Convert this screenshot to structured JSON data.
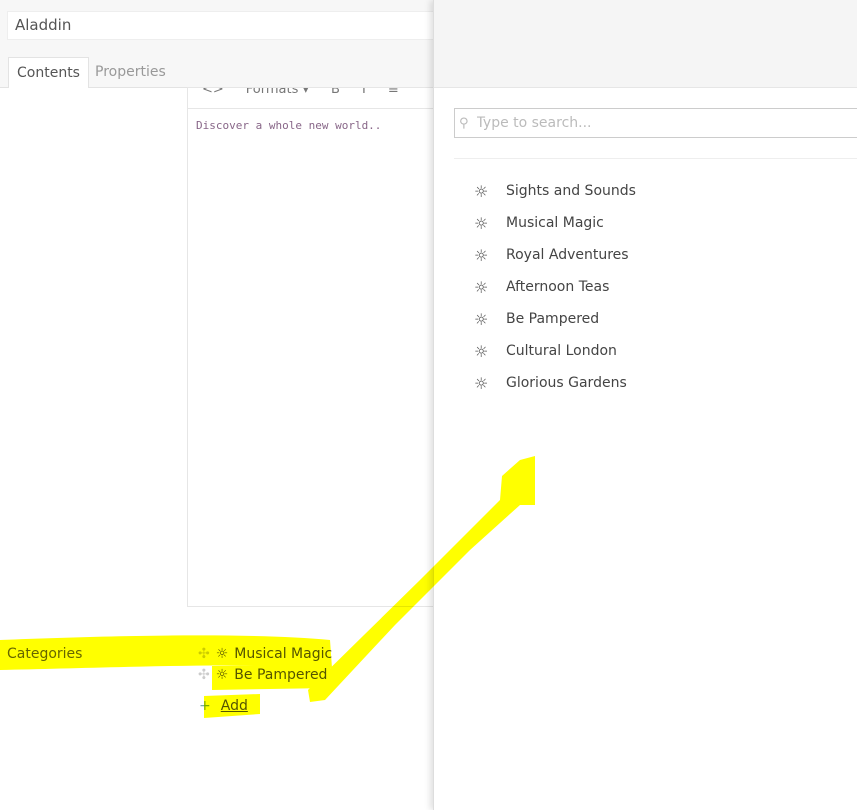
{
  "content": {
    "name": "Aladdin",
    "tabs": [
      "Contents",
      "Properties"
    ],
    "toolbar": [
      "<>",
      "Formats ▾",
      "B",
      "I",
      "≡"
    ],
    "editor_text": "Discover a whole new world.."
  },
  "categories": {
    "label": "Categories",
    "items": [
      "Musical Magic",
      "Be Pampered"
    ],
    "add_label": "Add"
  },
  "picker": {
    "search_placeholder": "Type to search...",
    "items": [
      "Sights and Sounds",
      "Musical Magic",
      "Royal Adventures",
      "Afternoon Teas",
      "Be Pampered",
      "Cultural London",
      "Glorious Gardens"
    ],
    "item_icon": "sun-icon"
  },
  "annotation_color": "#ffff00"
}
